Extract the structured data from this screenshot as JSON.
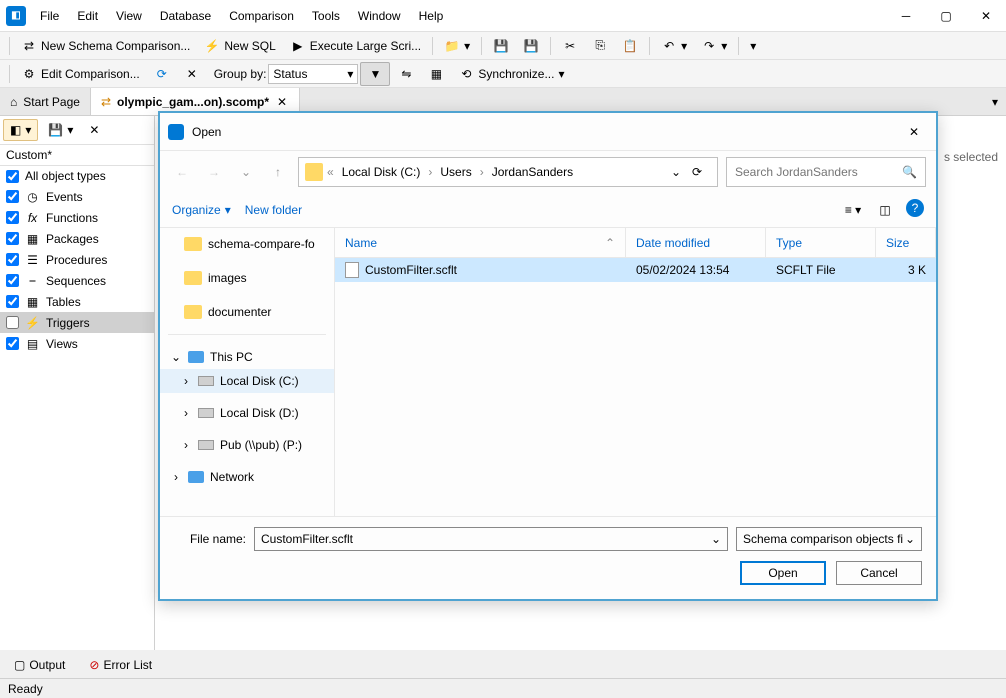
{
  "menus": [
    "File",
    "Edit",
    "View",
    "Database",
    "Comparison",
    "Tools",
    "Window",
    "Help"
  ],
  "toolbar1": {
    "new_schema": "New Schema Comparison...",
    "new_sql": "New SQL",
    "exec_large": "Execute Large Scri..."
  },
  "toolbar2": {
    "edit_comparison": "Edit Comparison...",
    "group_by_label": "Group by:",
    "group_by_value": "Status",
    "sync": "Synchronize..."
  },
  "tabs": {
    "start": "Start Page",
    "doc": "olympic_gam...on).scomp*"
  },
  "sidebar": {
    "label": "Custom*",
    "items": [
      {
        "label": "All object types"
      },
      {
        "label": "Events"
      },
      {
        "label": "Functions"
      },
      {
        "label": "Packages"
      },
      {
        "label": "Procedures"
      },
      {
        "label": "Sequences"
      },
      {
        "label": "Tables"
      },
      {
        "label": "Triggers"
      },
      {
        "label": "Views"
      }
    ]
  },
  "dialog": {
    "title": "Open",
    "breadcrumb": {
      "sep": "«",
      "p1": "Local Disk (C:)",
      "p2": "Users",
      "p3": "JordanSanders"
    },
    "search_placeholder": "Search JordanSanders",
    "organize": "Organize",
    "new_folder": "New folder",
    "tree": {
      "f1": "schema-compare-fo",
      "f2": "images",
      "f3": "documenter",
      "pc": "This PC",
      "d1": "Local Disk (C:)",
      "d2": "Local Disk (D:)",
      "d3": "Pub (\\\\pub) (P:)",
      "net": "Network"
    },
    "headers": {
      "name": "Name",
      "date": "Date modified",
      "type": "Type",
      "size": "Size"
    },
    "file": {
      "name": "CustomFilter.scflt",
      "date": "05/02/2024 13:54",
      "type": "SCFLT File",
      "size": "3 K"
    },
    "file_name_label": "File name:",
    "file_name_value": "CustomFilter.scflt",
    "filter": "Schema comparison objects filt",
    "open": "Open",
    "cancel": "Cancel"
  },
  "right_info": "s selected",
  "bottom": {
    "output": "Output",
    "errors": "Error List"
  },
  "status": "Ready"
}
